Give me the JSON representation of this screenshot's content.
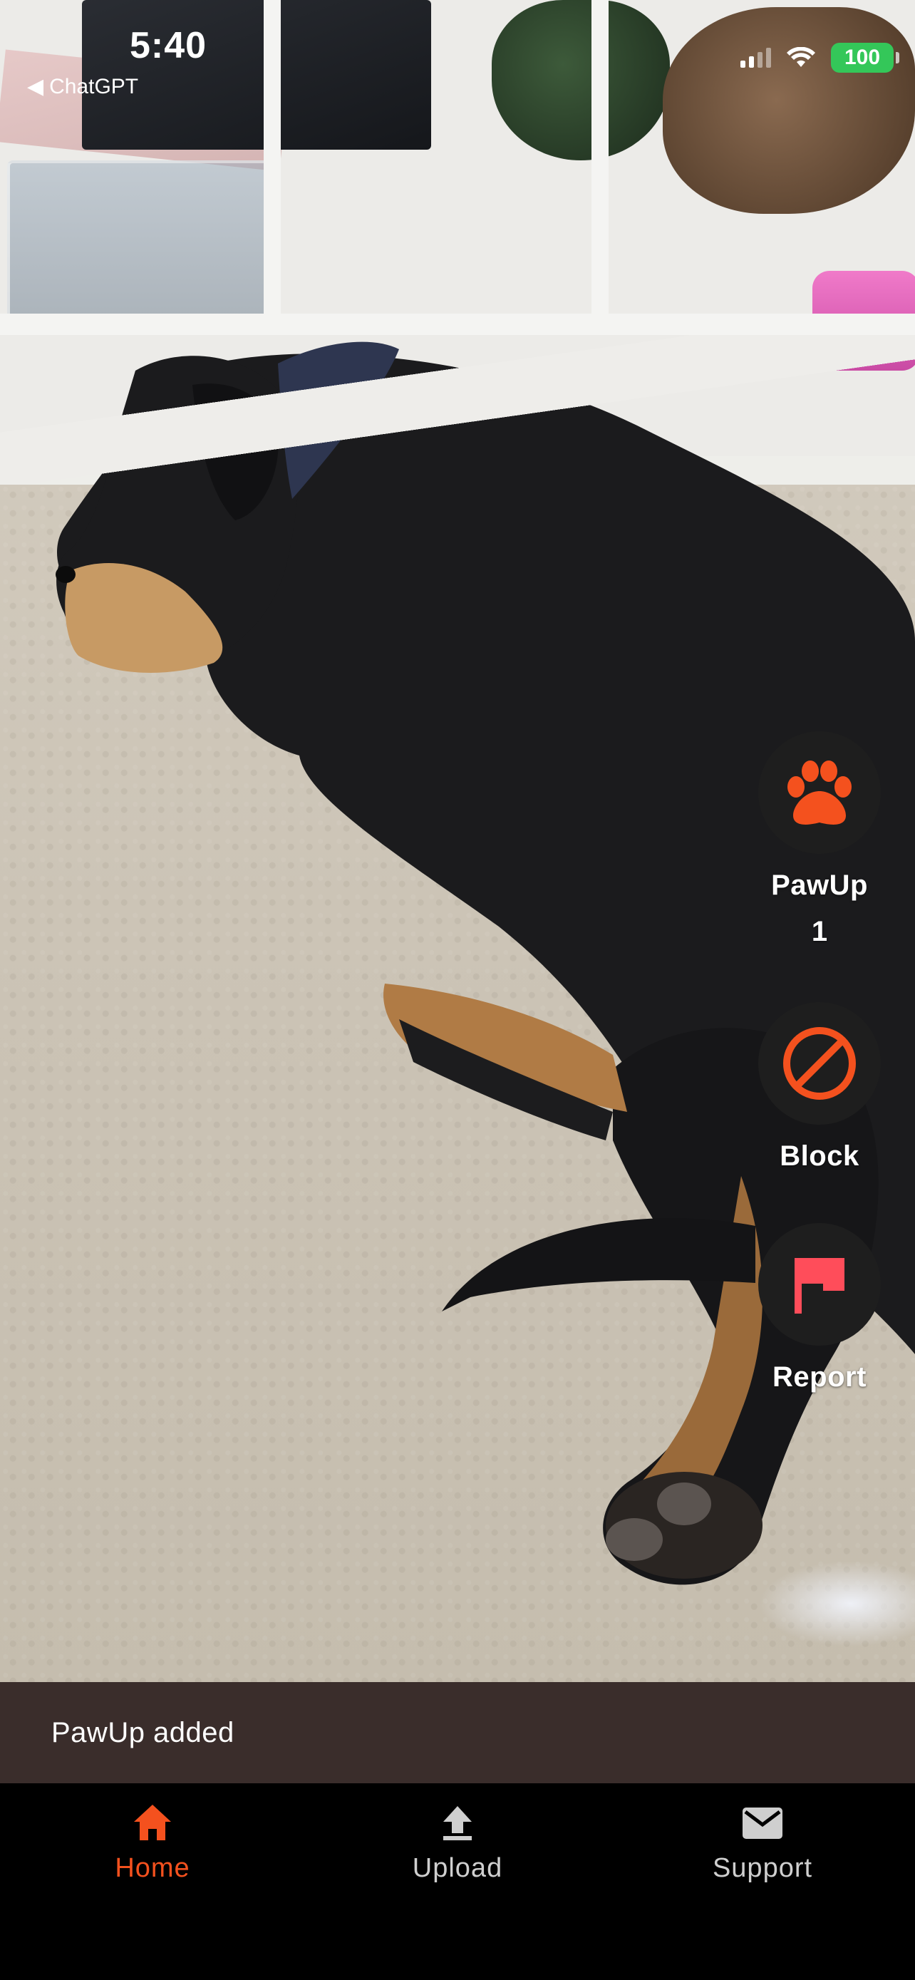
{
  "status_bar": {
    "time": "5:40",
    "back_app": "ChatGPT",
    "battery": "100"
  },
  "actions": {
    "pawup": {
      "label": "PawUp",
      "count": "1",
      "icon": "paw-icon",
      "color": "#f4511e"
    },
    "block": {
      "label": "Block",
      "icon": "block-icon",
      "color": "#f4511e"
    },
    "report": {
      "label": "Report",
      "icon": "flag-icon",
      "color": "#ff4d5a"
    }
  },
  "snackbar": {
    "message": "PawUp added"
  },
  "bottom_nav": {
    "active_color": "#f4511e",
    "items": [
      {
        "label": "Home",
        "icon": "home-icon",
        "active": true
      },
      {
        "label": "Upload",
        "icon": "upload-icon",
        "active": false
      },
      {
        "label": "Support",
        "icon": "mail-icon",
        "active": false
      }
    ]
  }
}
